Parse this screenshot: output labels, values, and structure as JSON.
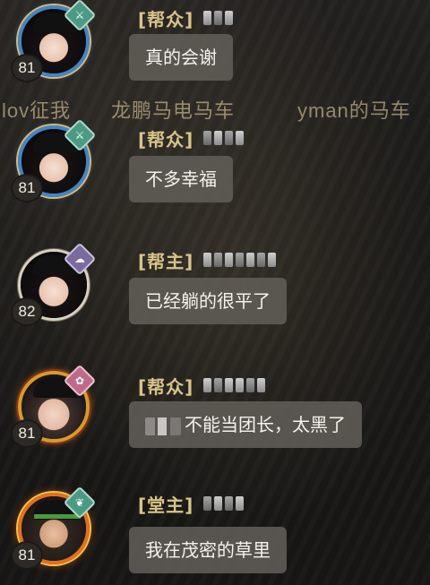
{
  "overlay": {
    "left_text": "lov征我",
    "middle_text": "龙鹏马电马车",
    "right_text": "yman的马车"
  },
  "messages": [
    {
      "level": "81",
      "rank": "[帮众]",
      "text": "真的会谢",
      "avatar_frame": "blue-flower-frame",
      "badge_icon": "sword-icon"
    },
    {
      "level": "81",
      "rank": "[帮众]",
      "text": "不多幸福",
      "avatar_frame": "blue-flower-frame",
      "badge_icon": "sword-icon"
    },
    {
      "level": "82",
      "rank": "[帮主]",
      "text": "已经躺的很平了",
      "avatar_frame": "plain-frame",
      "badge_icon": "cloud-icon"
    },
    {
      "level": "81",
      "rank": "[帮众]",
      "text": "不能当团长，太黑了",
      "avatar_frame": "golden-dragon-frame",
      "badge_icon": "lotus-icon"
    },
    {
      "level": "81",
      "rank": "[堂主]",
      "text": "我在茂密的草里",
      "avatar_frame": "flame-frame",
      "badge_icon": "leaf-icon"
    }
  ],
  "colors": {
    "rank": "#d8c489",
    "bubble_bg": "#615c56",
    "bubble_text": "#f5f2ed",
    "overlay_text": "#f0dcaa"
  }
}
